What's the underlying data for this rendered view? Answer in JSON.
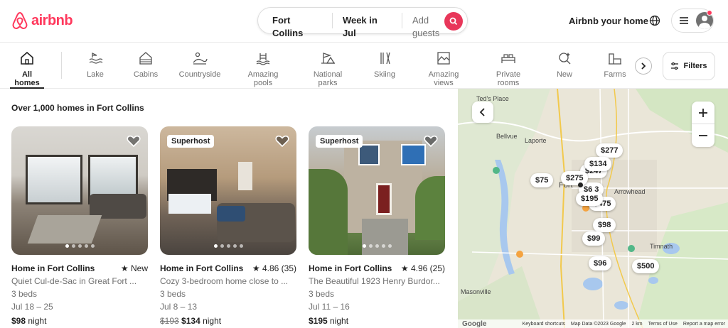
{
  "header": {
    "brand": "airbnb",
    "search": {
      "location": "Fort Collins",
      "dates": "Week in Jul",
      "guests_placeholder": "Add guests"
    },
    "host_link": "Airbnb your home"
  },
  "categories": [
    {
      "label": "All homes",
      "icon": "home-icon",
      "active": true
    },
    {
      "label": "Lake",
      "icon": "lake-icon"
    },
    {
      "label": "Cabins",
      "icon": "cabin-icon"
    },
    {
      "label": "Countryside",
      "icon": "countryside-icon"
    },
    {
      "label": "Amazing pools",
      "icon": "pool-icon"
    },
    {
      "label": "National parks",
      "icon": "national-park-icon"
    },
    {
      "label": "Skiing",
      "icon": "skiing-icon"
    },
    {
      "label": "Amazing views",
      "icon": "view-icon"
    },
    {
      "label": "Private rooms",
      "icon": "private-room-icon"
    },
    {
      "label": "New",
      "icon": "new-icon"
    },
    {
      "label": "Farms",
      "icon": "farm-icon"
    }
  ],
  "filters_label": "Filters",
  "results": {
    "count_text": "Over 1,000 homes in Fort Collins",
    "listings": [
      {
        "title": "Home in Fort Collins",
        "rating": "New",
        "description": "Quiet Cul-de-Sac in Great Fort ...",
        "beds": "3 beds",
        "dates": "Jul 18 – 25",
        "price": "$98",
        "price_unit": "night",
        "badge": ""
      },
      {
        "title": "Home in Fort Collins",
        "rating": "4.86 (35)",
        "description": "Cozy 3-bedroom home close to ...",
        "beds": "3 beds",
        "dates": "Jul 8 – 13",
        "old_price": "$193",
        "price": "$134",
        "price_unit": "night",
        "badge": "Superhost"
      },
      {
        "title": "Home in Fort Collins",
        "rating": "4.96 (25)",
        "description": "The Beautiful 1923 Henry Burdor...",
        "beds": "3 beds",
        "dates": "Jul 11 – 16",
        "price": "$195",
        "price_unit": "night",
        "badge": "Superhost"
      }
    ]
  },
  "map": {
    "places": [
      "Ted's Place",
      "Bellvue",
      "Laporte",
      "Fort",
      "Arrowhead",
      "Timnath",
      "Masonville"
    ],
    "pins": [
      "$277",
      "$134",
      "$247",
      "$75",
      "$275",
      "$6 3",
      "$195",
      "$475",
      "$98",
      "$99",
      "$96",
      "$500"
    ],
    "footer": {
      "brand": "Google",
      "shortcuts": "Keyboard shortcuts",
      "data": "Map Data ©2023 Google",
      "scale": "2 km",
      "terms": "Terms of Use",
      "report": "Report a map error"
    }
  }
}
